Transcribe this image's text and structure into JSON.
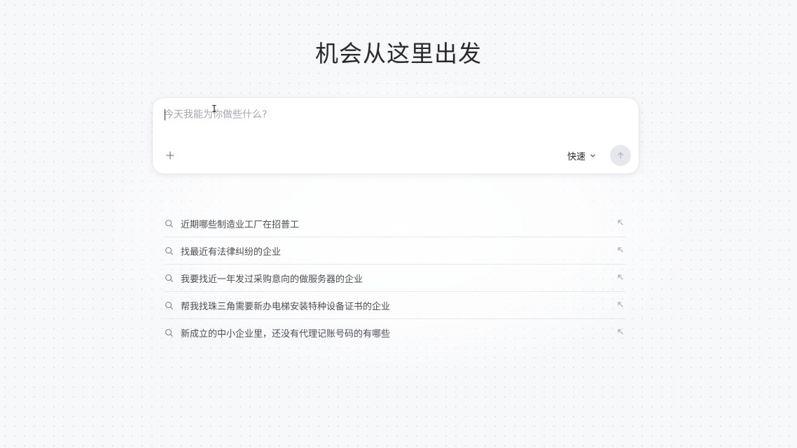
{
  "page": {
    "headline": "机会从这里出发"
  },
  "chat": {
    "placeholder": "今天我能为你做些什么?",
    "value": "",
    "add_icon": "plus-icon",
    "mode_label": "快速",
    "mode_icon": "chevron-down-icon",
    "send_icon": "arrow-up-icon"
  },
  "suggestions": {
    "icon": "search-icon",
    "action_icon": "arrow-up-left-icon",
    "items": [
      "近期哪些制造业工厂在招普工",
      "找最近有法律纠纷的企业",
      "我要找近一年发过采购意向的做服务器的企业",
      "帮我找珠三角需要新办电梯安装特种设备证书的企业",
      "新成立的中小企业里，还没有代理记账号码的有哪些"
    ]
  },
  "colors": {
    "background": "#f7f8fa",
    "card": "#ffffff",
    "send_button": "#e6e8ee",
    "text_primary": "#2a2a2a",
    "text_secondary": "#4a4d52",
    "placeholder": "#a4a7ad"
  }
}
